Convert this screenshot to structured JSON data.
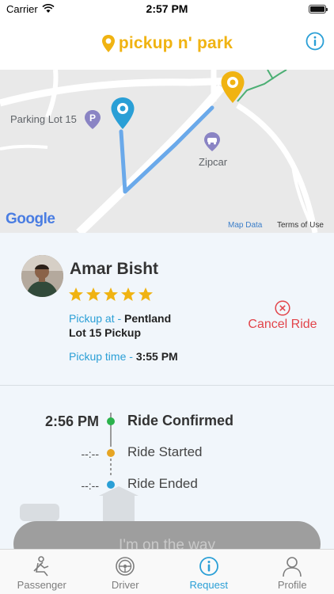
{
  "status_bar": {
    "carrier": "Carrier",
    "time": "2:57 PM"
  },
  "header": {
    "logo_text": "pickup n' park",
    "brand_color": "#f0b312",
    "info_icon": "info-icon"
  },
  "map": {
    "labels": {
      "parking_lot": "Parking Lot 15",
      "zipcar": "Zipcar"
    },
    "attribution": {
      "google": "Google",
      "map_data": "Map Data",
      "terms": "Terms of Use"
    },
    "route_color": "#6aa9ea"
  },
  "driver": {
    "name": "Amar Bisht",
    "rating": 5,
    "pickup_label": "Pickup at - ",
    "pickup_location_line1": "Pentland",
    "pickup_location_line2": "Lot 15 Pickup",
    "pickup_time_label": "Pickup time - ",
    "pickup_time": "3:55 PM",
    "cancel_label": "Cancel Ride"
  },
  "timeline": [
    {
      "time": "2:56 PM",
      "label": "Ride Confirmed",
      "color": "#2bb24c"
    },
    {
      "time": "--:--",
      "label": "Ride Started",
      "color": "#e6a524"
    },
    {
      "time": "--:--",
      "label": "Ride Ended",
      "color": "#2a9fd6"
    }
  ],
  "action_button": {
    "label": "I'm on the way"
  },
  "tabs": [
    {
      "label": "Passenger",
      "icon": "passenger-seat-icon",
      "active": false
    },
    {
      "label": "Driver",
      "icon": "steering-wheel-icon",
      "active": false
    },
    {
      "label": "Request",
      "icon": "info-icon",
      "active": true
    },
    {
      "label": "Profile",
      "icon": "person-icon",
      "active": false
    }
  ],
  "colors": {
    "accent_blue": "#2a9fd6",
    "cancel_red": "#e2444a",
    "star_gold": "#f0b312"
  }
}
